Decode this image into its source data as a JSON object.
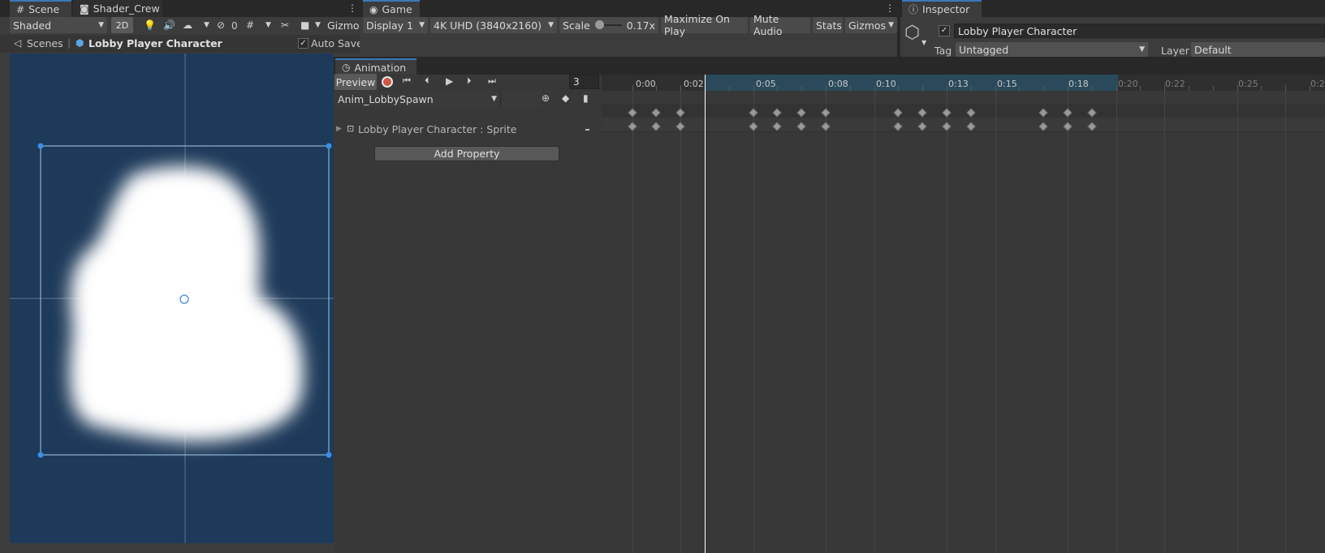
{
  "scene_tabs": {
    "scene": "Scene",
    "shader": "Shader_Crew"
  },
  "scene_toolbar": {
    "shading": "Shaded",
    "mode_2d": "2D",
    "hidden_count": "0",
    "gizmos": "Gizmos"
  },
  "scene_breadcrumb": {
    "root": "Scenes",
    "object": "Lobby Player Character",
    "auto_save": "Auto Save"
  },
  "game": {
    "tab": "Game",
    "display": "Display 1",
    "resolution": "4K UHD (3840x2160)",
    "scale_label": "Scale",
    "scale_value": "0.17x",
    "maximize": "Maximize On Play",
    "mute": "Mute Audio",
    "stats": "Stats",
    "gizmos": "Gizmos"
  },
  "inspector": {
    "tab": "Inspector",
    "object_name": "Lobby Player Character",
    "tag_label": "Tag",
    "tag_value": "Untagged",
    "layer_label": "Layer",
    "layer_value": "Default"
  },
  "animation": {
    "tab": "Animation",
    "preview": "Preview",
    "frame": "3",
    "clip": "Anim_LobbySpawn",
    "property": "Lobby Player Character : Sprite",
    "add_property": "Add Property",
    "ticks": [
      "0:00",
      "0:02",
      "0:05",
      "0:08",
      "0:10",
      "0:13",
      "0:15",
      "0:18",
      "0:20",
      "0:22",
      "0:25",
      "0:2"
    ],
    "keyframe_times": [
      "0:00",
      "0:01",
      "0:02",
      "0:05",
      "0:06",
      "0:07",
      "0:08",
      "0:11",
      "0:12",
      "0:13",
      "0:14",
      "0:17",
      "0:18",
      "0:19"
    ],
    "playhead": "0:03",
    "selected_range": [
      "0:03",
      "0:20"
    ]
  },
  "colors": {
    "scene_bg": "#1e3a5a",
    "accent": "#3a79bb",
    "record": "#d2573f"
  }
}
